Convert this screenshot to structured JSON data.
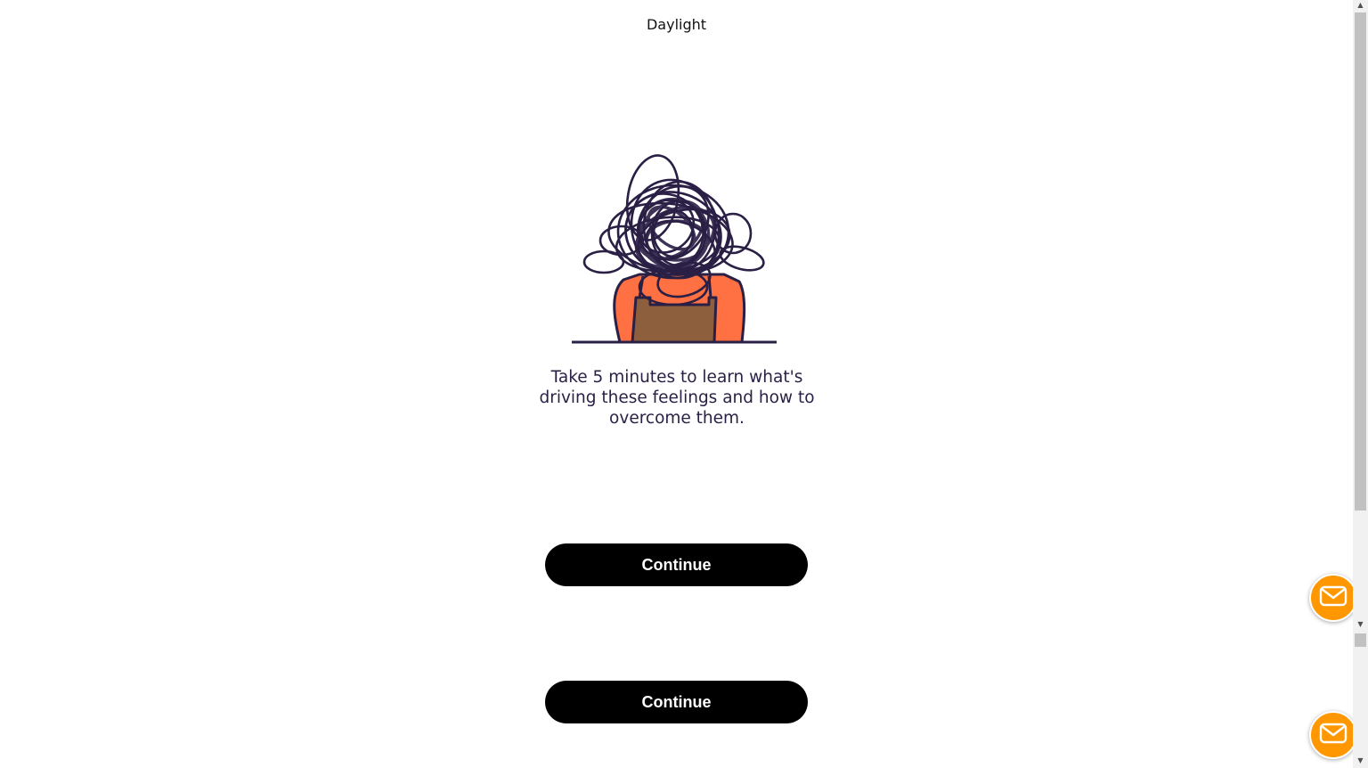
{
  "header": {
    "brand": "Daylight"
  },
  "main": {
    "illustration_icon": "stressed-person-scribble-head-illustration",
    "tagline": "Take 5 minutes to learn what's driving these feelings and how to overcome them.",
    "buttons": [
      {
        "label": "Continue"
      },
      {
        "label": "Continue"
      }
    ]
  },
  "floating": {
    "mail_icon": "mail-icon"
  },
  "colors": {
    "button_bg": "#000000",
    "button_text": "#ffffff",
    "tagline_text": "#2a1f45",
    "scribble": "#2a1f45",
    "shirt": "#ff7043",
    "apron": "#8d5f3c",
    "fab": "#ff9800"
  }
}
